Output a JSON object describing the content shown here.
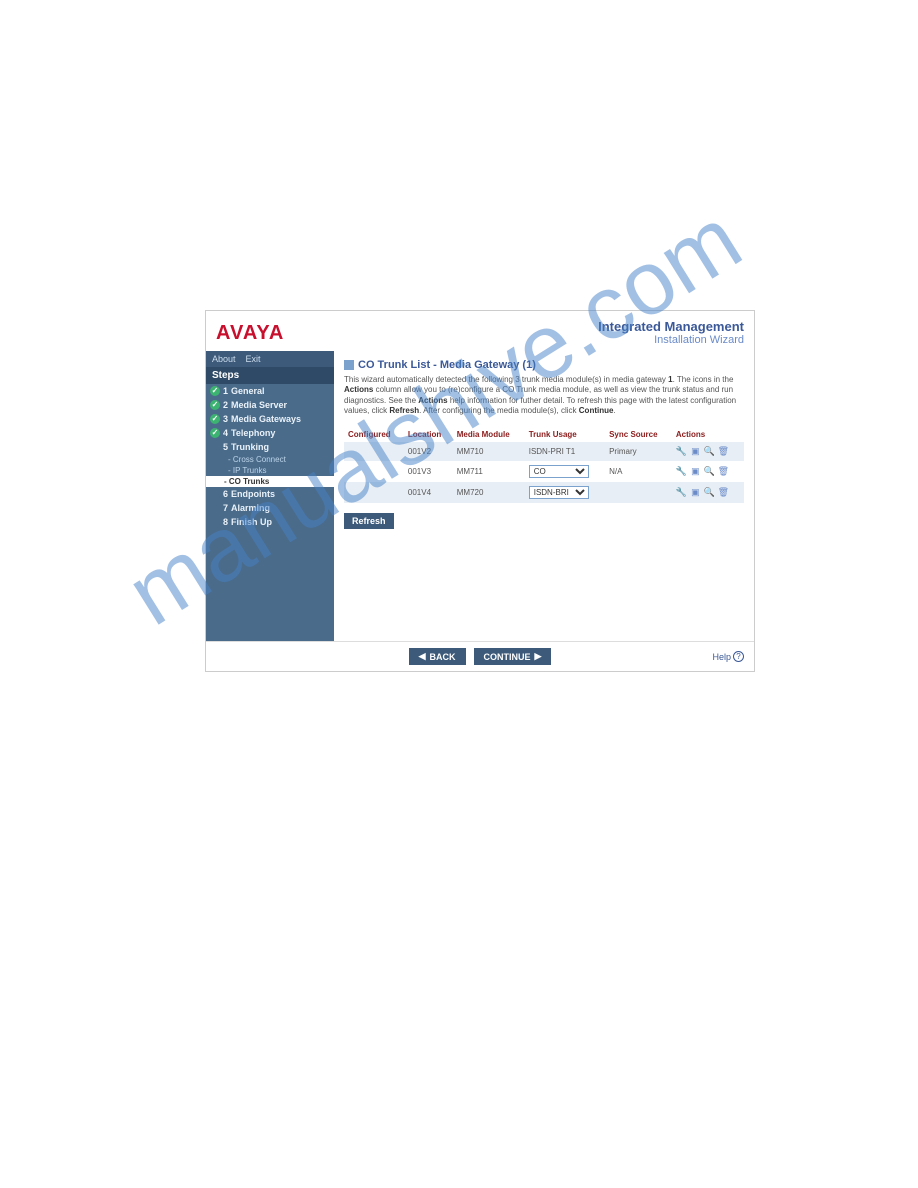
{
  "header": {
    "logo": "AVAYA",
    "title1": "Integrated Management",
    "title2": "Installation Wizard"
  },
  "menu": {
    "about": "About",
    "exit": "Exit"
  },
  "sidebar": {
    "stepsHeader": "Steps",
    "items": [
      {
        "num": "1",
        "label": "General",
        "done": true
      },
      {
        "num": "2",
        "label": "Media Server",
        "done": true
      },
      {
        "num": "3",
        "label": "Media Gateways",
        "done": true
      },
      {
        "num": "4",
        "label": "Telephony",
        "done": true
      },
      {
        "num": "5",
        "label": "Trunking",
        "done": false,
        "subs": [
          {
            "label": "Cross Connect",
            "active": false
          },
          {
            "label": "IP Trunks",
            "active": false
          },
          {
            "label": "CO Trunks",
            "active": true
          }
        ]
      },
      {
        "num": "6",
        "label": "Endpoints",
        "done": false
      },
      {
        "num": "7",
        "label": "Alarming",
        "done": false
      },
      {
        "num": "8",
        "label": "Finish Up",
        "done": false
      }
    ]
  },
  "page": {
    "title": "CO Trunk List - Media Gateway (1)",
    "desc_pre": "This wizard automatically detected the following 3 trunk media module(s) in media gateway ",
    "desc_gw": "1",
    "desc_mid1": ". The icons in the ",
    "desc_b1": "Actions",
    "desc_mid2": " column allow you to (re)configure a CO Trunk media module, as well as view the trunk status and run diagnostics. See the ",
    "desc_b2": "Actions",
    "desc_mid3": " help information for futher detail. To refresh this page with the latest configuration values, click ",
    "desc_b3": "Refresh",
    "desc_mid4": ". After configuring the media module(s), click ",
    "desc_b4": "Continue",
    "desc_end": "."
  },
  "table": {
    "headers": {
      "configured": "Configured",
      "location": "Location",
      "module": "Media Module",
      "usage": "Trunk Usage",
      "sync": "Sync Source",
      "actions": "Actions"
    },
    "rows": [
      {
        "configured": "",
        "location": "001V2",
        "module": "MM710",
        "usage": "ISDN-PRI T1",
        "usageDropdown": false,
        "sync": "Primary"
      },
      {
        "configured": "",
        "location": "001V3",
        "module": "MM711",
        "usage": "CO",
        "usageDropdown": true,
        "sync": "N/A"
      },
      {
        "configured": "",
        "location": "001V4",
        "module": "MM720",
        "usage": "ISDN-BRI",
        "usageDropdown": true,
        "sync": ""
      }
    ]
  },
  "buttons": {
    "refresh": "Refresh",
    "back": "BACK",
    "continue": "CONTINUE",
    "help": "Help"
  },
  "watermark": "manualshive.com"
}
